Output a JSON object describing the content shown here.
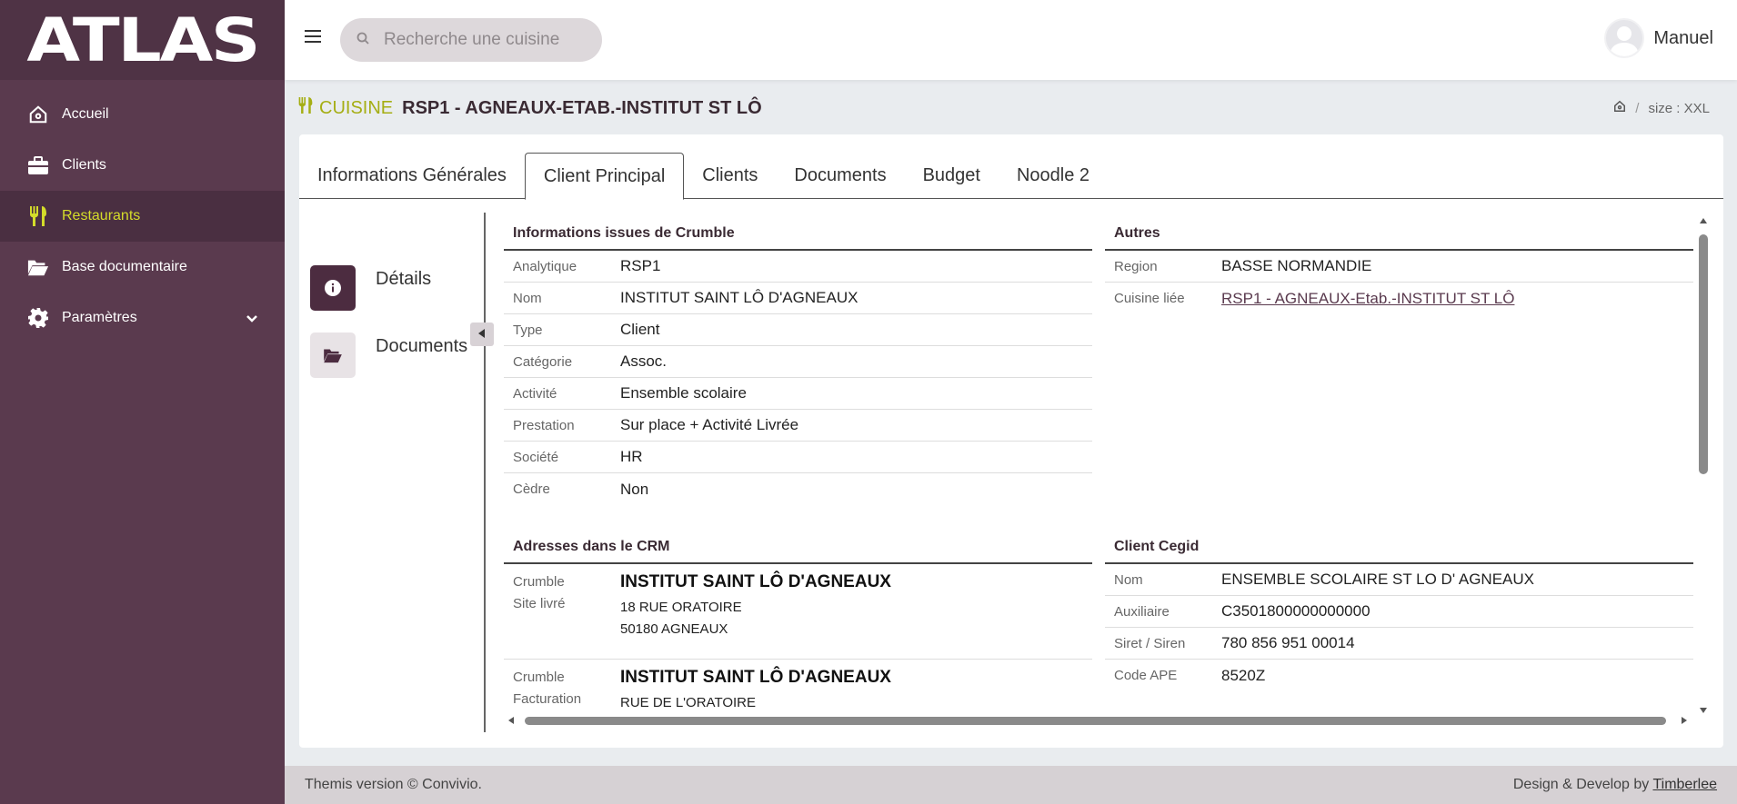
{
  "sidebar": {
    "logo": "ATLAS",
    "items": [
      {
        "label": "Accueil",
        "icon": "home-icon"
      },
      {
        "label": "Clients",
        "icon": "briefcase-icon"
      },
      {
        "label": "Restaurants",
        "icon": "utensils-icon",
        "active": true
      },
      {
        "label": "Base documentaire",
        "icon": "folder-open-icon"
      },
      {
        "label": "Paramètres",
        "icon": "gear-icon"
      }
    ]
  },
  "header": {
    "search_placeholder": "Recherche une cuisine",
    "user_name": "Manuel"
  },
  "page": {
    "label": "CUISINE",
    "name": "RSP1 - AGNEAUX-ETAB.-INSTITUT ST LÔ",
    "breadcrumb_sep": "/",
    "breadcrumb_text": "size : XXL"
  },
  "tabs": [
    "Informations Générales",
    "Client Principal",
    "Clients",
    "Documents",
    "Budget",
    "Noodle 2"
  ],
  "subnav": {
    "details": "Détails",
    "documents": "Documents"
  },
  "crumble": {
    "title": "Informations issues de Crumble",
    "rows": [
      {
        "k": "Analytique",
        "v": "RSP1"
      },
      {
        "k": "Nom",
        "v": "INSTITUT SAINT LÔ D'AGNEAUX"
      },
      {
        "k": "Type",
        "v": "Client"
      },
      {
        "k": "Catégorie",
        "v": "Assoc."
      },
      {
        "k": "Activité",
        "v": "Ensemble scolaire"
      },
      {
        "k": "Prestation",
        "v": "Sur place + Activité Livrée"
      },
      {
        "k": "Société",
        "v": "HR"
      },
      {
        "k": "Cèdre",
        "v": "Non"
      }
    ]
  },
  "autres": {
    "title": "Autres",
    "rows": [
      {
        "k": "Region",
        "v": "BASSE NORMANDIE"
      },
      {
        "k": "Cuisine liée",
        "v": "RSP1 - AGNEAUX-Etab.-INSTITUT ST LÔ"
      }
    ]
  },
  "crm": {
    "title": "Adresses dans le CRM",
    "items": [
      {
        "k1": "Crumble",
        "k2": "Site livré",
        "name": "INSTITUT SAINT LÔ D'AGNEAUX",
        "line1": "18 RUE ORATOIRE",
        "line2": "50180 AGNEAUX"
      },
      {
        "k1": "Crumble",
        "k2": "Facturation",
        "name": "INSTITUT SAINT LÔ D'AGNEAUX",
        "line1": "RUE DE L'ORATOIRE",
        "line2": ""
      }
    ]
  },
  "cegid": {
    "title": "Client Cegid",
    "rows": [
      {
        "k": "Nom",
        "v": "ENSEMBLE SCOLAIRE ST LO D' AGNEAUX"
      },
      {
        "k": "Auxiliaire",
        "v": "C3501800000000000"
      },
      {
        "k": "Siret / Siren",
        "v": "780 856 951 00014"
      },
      {
        "k": "Code APE",
        "v": "8520Z"
      }
    ]
  },
  "footer": {
    "left": "Themis version © Convivio.",
    "right_prefix": "Design & Develop by",
    "right_link": "Timberlee"
  }
}
